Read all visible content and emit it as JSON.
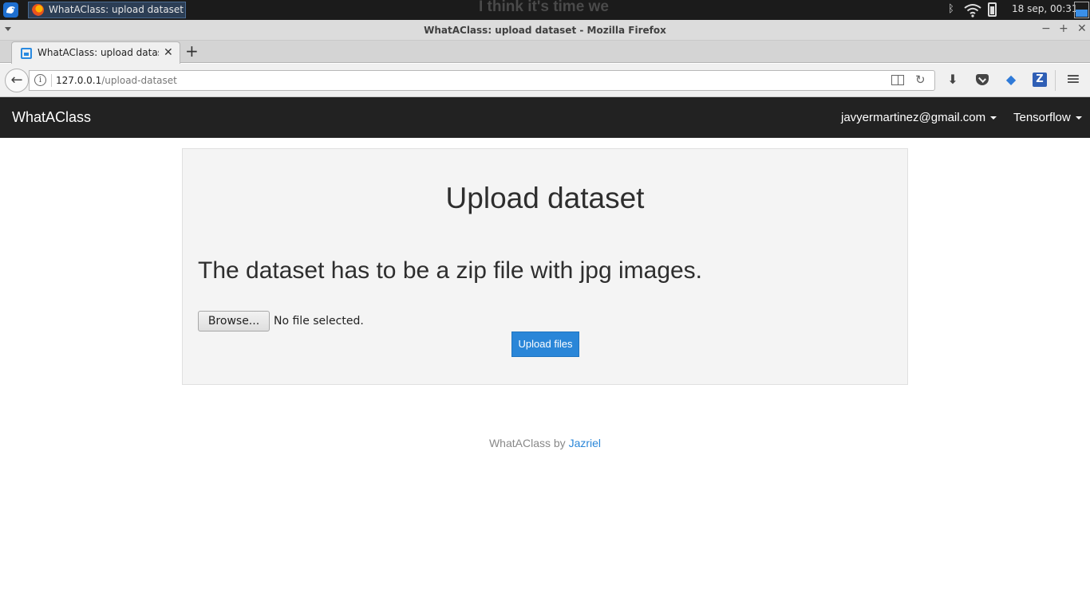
{
  "taskbar": {
    "task_title": "WhatAClass: upload dataset ...",
    "overlay_text": "I think it's time we",
    "bluetooth_icon": "ᛒ",
    "clock": "18 sep, 00:31"
  },
  "window": {
    "title": "WhatAClass: upload dataset - Mozilla Firefox",
    "minimize": "−",
    "maximize": "+",
    "close": "✕"
  },
  "tab": {
    "label": "WhatAClass: upload datase",
    "close": "✕",
    "new_tab": "+"
  },
  "urlbar": {
    "info": "i",
    "host": "127.0.0.1",
    "path": "/upload-dataset",
    "reload": "↻"
  },
  "toolbar": {
    "back": "←",
    "download": "⬇",
    "extension": "◆",
    "z": "Z",
    "menu": "≡"
  },
  "site": {
    "brand": "WhatAClass",
    "user_menu": "javyermartinez@gmail.com",
    "framework_menu": "Tensorflow"
  },
  "upload": {
    "heading": "Upload dataset",
    "instructions": "The dataset has to be a zip file with jpg images.",
    "browse_label": "Browse...",
    "file_status": "No file selected.",
    "submit_label": "Upload files"
  },
  "footer": {
    "text": "WhatAClass by ",
    "author": "Jazriel"
  }
}
